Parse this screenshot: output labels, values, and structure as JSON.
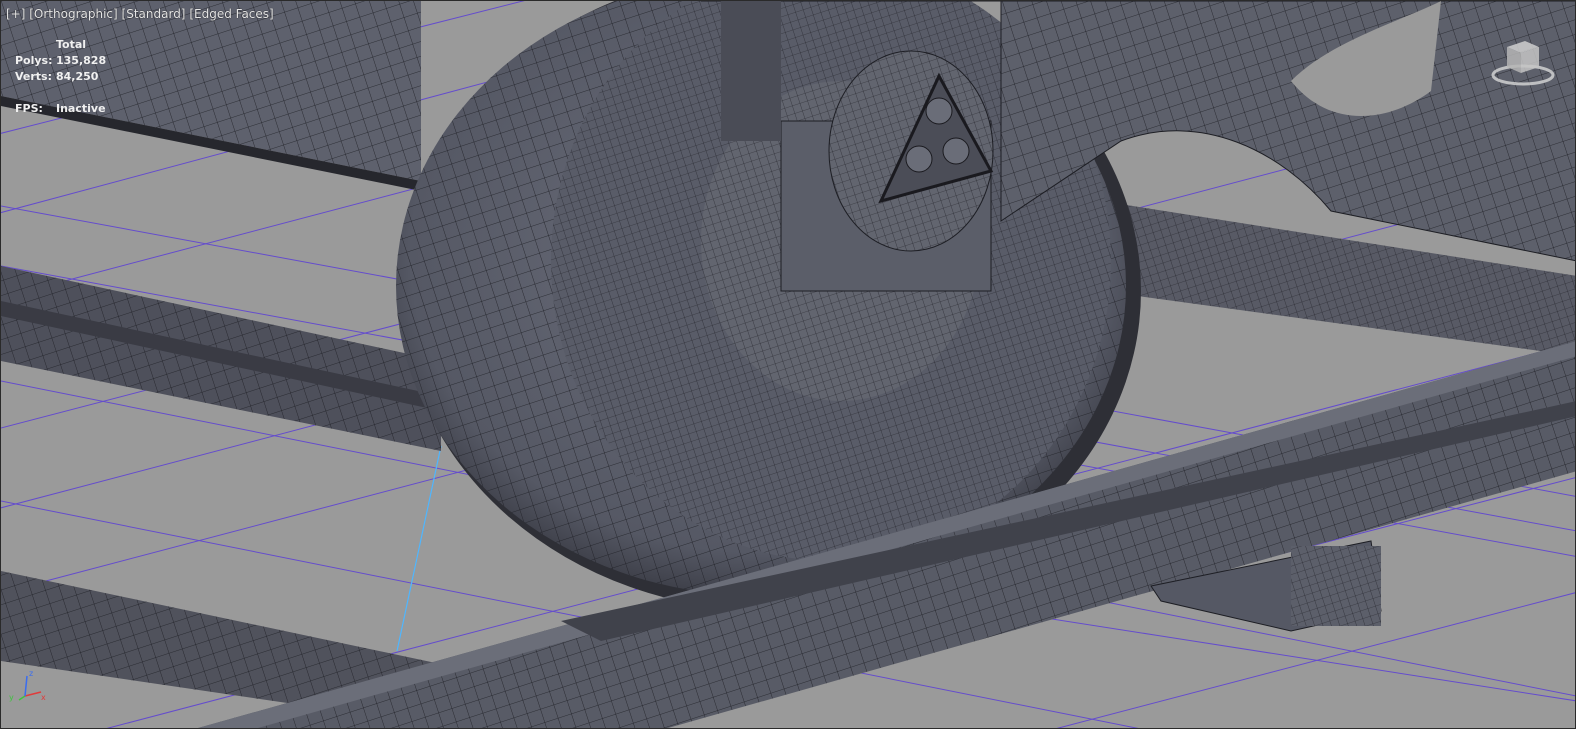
{
  "viewport": {
    "label_parts": [
      "[+]",
      "[Orthographic]",
      "[Standard]",
      "[Edged Faces]"
    ]
  },
  "stats": {
    "header": "Total",
    "polys_label": "Polys:",
    "polys_value": "135,828",
    "verts_label": "Verts:",
    "verts_value": "84,250",
    "fps_label": "FPS:",
    "fps_value": "Inactive"
  },
  "axes": {
    "x": "x",
    "y": "y",
    "z": "z"
  },
  "colors": {
    "background": "#9a9a9a",
    "grid": "#5b3fd6",
    "mesh_fill": "#5f6270",
    "mesh_dark": "#464853",
    "wire": "#1b1b20",
    "axis_x": "#e03b3b",
    "axis_y": "#3ec43e",
    "axis_z": "#3a6df0"
  }
}
